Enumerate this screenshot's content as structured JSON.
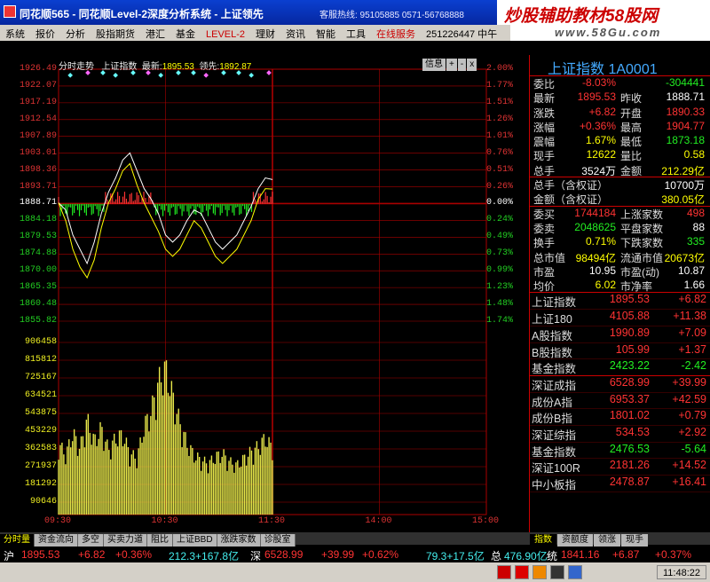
{
  "window": {
    "title": "同花顺565 - 同花顺Level-2深度分析系统 - 上证领先",
    "hotline": "客服热线: 95105885  0571-56768888",
    "ad_text": "炒股辅助教材58股网",
    "ad_url": "www.58Gu.com"
  },
  "menu": [
    "系统",
    "报价",
    "分析",
    "股指期货",
    "港汇",
    "基金",
    "LEVEL-2",
    "理财",
    "资讯",
    "智能",
    "工具",
    "在线服务",
    "251226447  中午"
  ],
  "chart": {
    "header_label": "分时走势",
    "index_name": "上证指数",
    "latest_label": "最新:",
    "latest_value": "1895.53",
    "lead_label": "领先:",
    "lead_value": "1892.87",
    "buttons": [
      "信息",
      "+",
      "-",
      "x"
    ],
    "price_ticks": [
      "1926.49",
      "1922.07",
      "1917.19",
      "1912.54",
      "1907.89",
      "1903.01",
      "1898.36",
      "1893.71",
      "1888.71",
      "1884.18",
      "1879.53",
      "1874.88",
      "1870.00",
      "1865.35",
      "1860.48",
      "1855.82"
    ],
    "pct_ticks": [
      "2.00%",
      "1.77%",
      "1.51%",
      "1.26%",
      "1.01%",
      "0.76%",
      "0.51%",
      "0.26%",
      "0.00%",
      "0.24%",
      "0.49%",
      "0.73%",
      "0.99%",
      "1.23%",
      "1.48%",
      "1.74%"
    ],
    "volume_ticks": [
      "906458",
      "815812",
      "725167",
      "634521",
      "543875",
      "453229",
      "362583",
      "271937",
      "181292",
      "90646"
    ],
    "time_ticks": [
      "09:30",
      "10:30",
      "11:30",
      "14:00",
      "15:00"
    ]
  },
  "chart_data": {
    "type": "line",
    "title": "",
    "prev_close": 1888.71,
    "ylim": [
      1855.82,
      1926.49
    ],
    "volume_ylim": [
      0,
      950000
    ],
    "x_labels": [
      "09:30",
      "10:30",
      "11:30",
      "14:00",
      "15:00"
    ],
    "series": [
      {
        "name": "最新",
        "values": [
          1889,
          1887,
          1880,
          1876,
          1872,
          1878,
          1886,
          1892,
          1896,
          1901,
          1903,
          1898,
          1893,
          1890,
          1886,
          1880,
          1878,
          1880,
          1884,
          1887,
          1886,
          1882,
          1878,
          1876,
          1878,
          1880,
          1884,
          1888,
          1893,
          1896,
          1895.53
        ]
      },
      {
        "name": "领先",
        "values": [
          1889,
          1884,
          1876,
          1871,
          1868,
          1873,
          1882,
          1889,
          1893,
          1898,
          1900,
          1894,
          1889,
          1885,
          1881,
          1876,
          1874,
          1876,
          1880,
          1884,
          1882,
          1878,
          1874,
          1872,
          1874,
          1876,
          1880,
          1884,
          1890,
          1893,
          1892.87
        ]
      }
    ],
    "volume": [
      420000,
      350000,
      480000,
      390000,
      560000,
      430000,
      510000,
      380000,
      450000,
      470000,
      360000,
      330000,
      520000,
      610000,
      780000,
      860000,
      700000,
      540000,
      420000,
      350000,
      320000,
      300000,
      340000,
      360000,
      310000,
      290000,
      330000,
      370000,
      400000,
      450000,
      390000
    ]
  },
  "quote": {
    "title": "上证指数 1A0001",
    "rows": [
      {
        "k1": "委比",
        "v1": "-8.03%",
        "c1": "red",
        "k2": "",
        "v2": "-304441",
        "c2": "grn"
      },
      {
        "k1": "最新",
        "v1": "1895.53",
        "c1": "red",
        "k2": "昨收",
        "v2": "1888.71",
        "c2": "wht"
      },
      {
        "k1": "涨跌",
        "v1": "+6.82",
        "c1": "red",
        "k2": "开盘",
        "v2": "1890.33",
        "c2": "red"
      },
      {
        "k1": "涨幅",
        "v1": "+0.36%",
        "c1": "red",
        "k2": "最高",
        "v2": "1904.77",
        "c2": "red"
      },
      {
        "k1": "震幅",
        "v1": "1.67%",
        "c1": "yel",
        "k2": "最低",
        "v2": "1873.18",
        "c2": "grn"
      },
      {
        "k1": "现手",
        "v1": "12622",
        "c1": "yel",
        "k2": "量比",
        "v2": "0.58",
        "c2": "yel"
      },
      {
        "k1": "总手",
        "v1": "3524万",
        "c1": "wht",
        "k2": "金额",
        "v2": "212.29亿",
        "c2": "yel"
      }
    ],
    "rows2": [
      {
        "k1": "总手（含权证）",
        "v2": "10700万",
        "c2": "wht"
      },
      {
        "k1": "金额（含权证）",
        "v2": "380.05亿",
        "c2": "yel"
      }
    ],
    "rows3": [
      {
        "k1": "委买",
        "v1": "1744184",
        "c1": "red",
        "k2": "上涨家数",
        "v2": "498",
        "c2": "red"
      },
      {
        "k1": "委卖",
        "v1": "2048625",
        "c1": "grn",
        "k2": "平盘家数",
        "v2": "88",
        "c2": "wht"
      },
      {
        "k1": "换手",
        "v1": "0.71%",
        "c1": "yel",
        "k2": "下跌家数",
        "v2": "335",
        "c2": "grn"
      },
      {
        "k1": "总市值",
        "v1": "98494亿",
        "c1": "yel",
        "k2": "流通市值",
        "v2": "20673亿",
        "c2": "yel"
      },
      {
        "k1": "市盈",
        "v1": "10.95",
        "c1": "wht",
        "k2": "市盈(动)",
        "v2": "10.87",
        "c2": "wht"
      },
      {
        "k1": "均价",
        "v1": "6.02",
        "c1": "yel",
        "k2": "市净率",
        "v2": "1.66",
        "c2": "wht"
      }
    ]
  },
  "indices": [
    {
      "name": "上证指数",
      "price": "1895.53",
      "chg": "+6.82",
      "c": "red"
    },
    {
      "name": "上证180",
      "price": "4105.88",
      "chg": "+11.38",
      "c": "red"
    },
    {
      "name": "A股指数",
      "price": "1990.89",
      "chg": "+7.09",
      "c": "red"
    },
    {
      "name": "B股指数",
      "price": "105.99",
      "chg": "+1.37",
      "c": "red"
    },
    {
      "name": "基金指数",
      "price": "2423.22",
      "chg": "-2.42",
      "c": "grn"
    },
    {
      "name": "深证成指",
      "price": "6528.99",
      "chg": "+39.99",
      "c": "red"
    },
    {
      "name": "成份A指",
      "price": "6953.37",
      "chg": "+42.59",
      "c": "red"
    },
    {
      "name": "成份B指",
      "price": "1801.02",
      "chg": "+0.79",
      "c": "red"
    },
    {
      "name": "深证综指",
      "price": "534.53",
      "chg": "+2.92",
      "c": "red"
    },
    {
      "name": "基金指数",
      "price": "2476.53",
      "chg": "-5.64",
      "c": "grn"
    },
    {
      "name": "深证100R",
      "price": "2181.26",
      "chg": "+14.52",
      "c": "red"
    },
    {
      "name": "中小板指",
      "price": "2478.87",
      "chg": "+16.41",
      "c": "red"
    }
  ],
  "bottom_tabs": [
    "分时量",
    "资金流向",
    "多空",
    "买卖力道",
    "阻比",
    "上证BBD",
    "涨跌家数",
    "诊股室"
  ],
  "right_tabs": [
    "指数",
    "资额度",
    "领涨",
    "现手"
  ],
  "status": {
    "sh_label": "沪",
    "sh_price": "1895.53",
    "sh_chg": "+6.82",
    "sh_pct": "+0.36%",
    "sh_amt": "212.3+167.8亿",
    "sz_label": "深",
    "sz_price": "6528.99",
    "sz_chg": "+39.99",
    "sz_pct": "+0.62%",
    "sz_amt": "79.3+17.5亿",
    "total_label": "总",
    "total_amt": "476.90亿",
    "tong_label": "统",
    "tong_price": "1841.16",
    "tong_chg": "+6.87",
    "tong_pct": "+0.37%"
  },
  "clock": "11:48:22",
  "colors": {
    "up": "#ff3333",
    "down": "#22ee22",
    "grid": "#aa0000",
    "price_line": "#ffffff",
    "lead_line": "#ffff00",
    "volume": "#e8e84a"
  }
}
